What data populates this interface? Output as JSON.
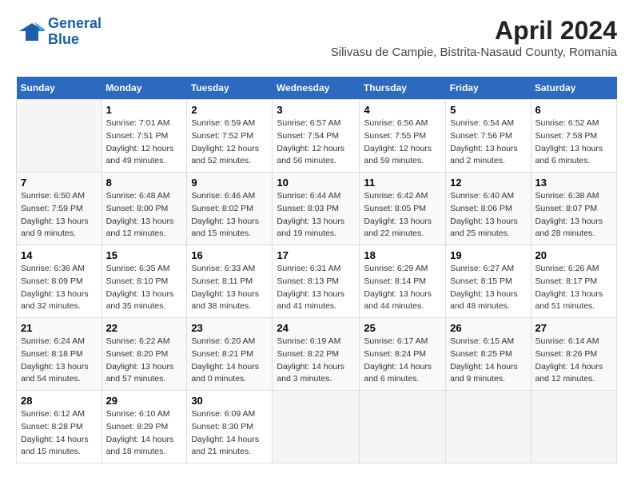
{
  "header": {
    "logo_line1": "General",
    "logo_line2": "Blue",
    "title": "April 2024",
    "subtitle": "Silivasu de Campie, Bistrita-Nasaud County, Romania"
  },
  "days_of_week": [
    "Sunday",
    "Monday",
    "Tuesday",
    "Wednesday",
    "Thursday",
    "Friday",
    "Saturday"
  ],
  "weeks": [
    [
      {
        "day": "",
        "sunrise": "",
        "sunset": "",
        "daylight": ""
      },
      {
        "day": "1",
        "sunrise": "Sunrise: 7:01 AM",
        "sunset": "Sunset: 7:51 PM",
        "daylight": "Daylight: 12 hours and 49 minutes."
      },
      {
        "day": "2",
        "sunrise": "Sunrise: 6:59 AM",
        "sunset": "Sunset: 7:52 PM",
        "daylight": "Daylight: 12 hours and 52 minutes."
      },
      {
        "day": "3",
        "sunrise": "Sunrise: 6:57 AM",
        "sunset": "Sunset: 7:54 PM",
        "daylight": "Daylight: 12 hours and 56 minutes."
      },
      {
        "day": "4",
        "sunrise": "Sunrise: 6:56 AM",
        "sunset": "Sunset: 7:55 PM",
        "daylight": "Daylight: 12 hours and 59 minutes."
      },
      {
        "day": "5",
        "sunrise": "Sunrise: 6:54 AM",
        "sunset": "Sunset: 7:56 PM",
        "daylight": "Daylight: 13 hours and 2 minutes."
      },
      {
        "day": "6",
        "sunrise": "Sunrise: 6:52 AM",
        "sunset": "Sunset: 7:58 PM",
        "daylight": "Daylight: 13 hours and 6 minutes."
      }
    ],
    [
      {
        "day": "7",
        "sunrise": "Sunrise: 6:50 AM",
        "sunset": "Sunset: 7:59 PM",
        "daylight": "Daylight: 13 hours and 9 minutes."
      },
      {
        "day": "8",
        "sunrise": "Sunrise: 6:48 AM",
        "sunset": "Sunset: 8:00 PM",
        "daylight": "Daylight: 13 hours and 12 minutes."
      },
      {
        "day": "9",
        "sunrise": "Sunrise: 6:46 AM",
        "sunset": "Sunset: 8:02 PM",
        "daylight": "Daylight: 13 hours and 15 minutes."
      },
      {
        "day": "10",
        "sunrise": "Sunrise: 6:44 AM",
        "sunset": "Sunset: 8:03 PM",
        "daylight": "Daylight: 13 hours and 19 minutes."
      },
      {
        "day": "11",
        "sunrise": "Sunrise: 6:42 AM",
        "sunset": "Sunset: 8:05 PM",
        "daylight": "Daylight: 13 hours and 22 minutes."
      },
      {
        "day": "12",
        "sunrise": "Sunrise: 6:40 AM",
        "sunset": "Sunset: 8:06 PM",
        "daylight": "Daylight: 13 hours and 25 minutes."
      },
      {
        "day": "13",
        "sunrise": "Sunrise: 6:38 AM",
        "sunset": "Sunset: 8:07 PM",
        "daylight": "Daylight: 13 hours and 28 minutes."
      }
    ],
    [
      {
        "day": "14",
        "sunrise": "Sunrise: 6:36 AM",
        "sunset": "Sunset: 8:09 PM",
        "daylight": "Daylight: 13 hours and 32 minutes."
      },
      {
        "day": "15",
        "sunrise": "Sunrise: 6:35 AM",
        "sunset": "Sunset: 8:10 PM",
        "daylight": "Daylight: 13 hours and 35 minutes."
      },
      {
        "day": "16",
        "sunrise": "Sunrise: 6:33 AM",
        "sunset": "Sunset: 8:11 PM",
        "daylight": "Daylight: 13 hours and 38 minutes."
      },
      {
        "day": "17",
        "sunrise": "Sunrise: 6:31 AM",
        "sunset": "Sunset: 8:13 PM",
        "daylight": "Daylight: 13 hours and 41 minutes."
      },
      {
        "day": "18",
        "sunrise": "Sunrise: 6:29 AM",
        "sunset": "Sunset: 8:14 PM",
        "daylight": "Daylight: 13 hours and 44 minutes."
      },
      {
        "day": "19",
        "sunrise": "Sunrise: 6:27 AM",
        "sunset": "Sunset: 8:15 PM",
        "daylight": "Daylight: 13 hours and 48 minutes."
      },
      {
        "day": "20",
        "sunrise": "Sunrise: 6:26 AM",
        "sunset": "Sunset: 8:17 PM",
        "daylight": "Daylight: 13 hours and 51 minutes."
      }
    ],
    [
      {
        "day": "21",
        "sunrise": "Sunrise: 6:24 AM",
        "sunset": "Sunset: 8:18 PM",
        "daylight": "Daylight: 13 hours and 54 minutes."
      },
      {
        "day": "22",
        "sunrise": "Sunrise: 6:22 AM",
        "sunset": "Sunset: 8:20 PM",
        "daylight": "Daylight: 13 hours and 57 minutes."
      },
      {
        "day": "23",
        "sunrise": "Sunrise: 6:20 AM",
        "sunset": "Sunset: 8:21 PM",
        "daylight": "Daylight: 14 hours and 0 minutes."
      },
      {
        "day": "24",
        "sunrise": "Sunrise: 6:19 AM",
        "sunset": "Sunset: 8:22 PM",
        "daylight": "Daylight: 14 hours and 3 minutes."
      },
      {
        "day": "25",
        "sunrise": "Sunrise: 6:17 AM",
        "sunset": "Sunset: 8:24 PM",
        "daylight": "Daylight: 14 hours and 6 minutes."
      },
      {
        "day": "26",
        "sunrise": "Sunrise: 6:15 AM",
        "sunset": "Sunset: 8:25 PM",
        "daylight": "Daylight: 14 hours and 9 minutes."
      },
      {
        "day": "27",
        "sunrise": "Sunrise: 6:14 AM",
        "sunset": "Sunset: 8:26 PM",
        "daylight": "Daylight: 14 hours and 12 minutes."
      }
    ],
    [
      {
        "day": "28",
        "sunrise": "Sunrise: 6:12 AM",
        "sunset": "Sunset: 8:28 PM",
        "daylight": "Daylight: 14 hours and 15 minutes."
      },
      {
        "day": "29",
        "sunrise": "Sunrise: 6:10 AM",
        "sunset": "Sunset: 8:29 PM",
        "daylight": "Daylight: 14 hours and 18 minutes."
      },
      {
        "day": "30",
        "sunrise": "Sunrise: 6:09 AM",
        "sunset": "Sunset: 8:30 PM",
        "daylight": "Daylight: 14 hours and 21 minutes."
      },
      {
        "day": "",
        "sunrise": "",
        "sunset": "",
        "daylight": ""
      },
      {
        "day": "",
        "sunrise": "",
        "sunset": "",
        "daylight": ""
      },
      {
        "day": "",
        "sunrise": "",
        "sunset": "",
        "daylight": ""
      },
      {
        "day": "",
        "sunrise": "",
        "sunset": "",
        "daylight": ""
      }
    ]
  ]
}
